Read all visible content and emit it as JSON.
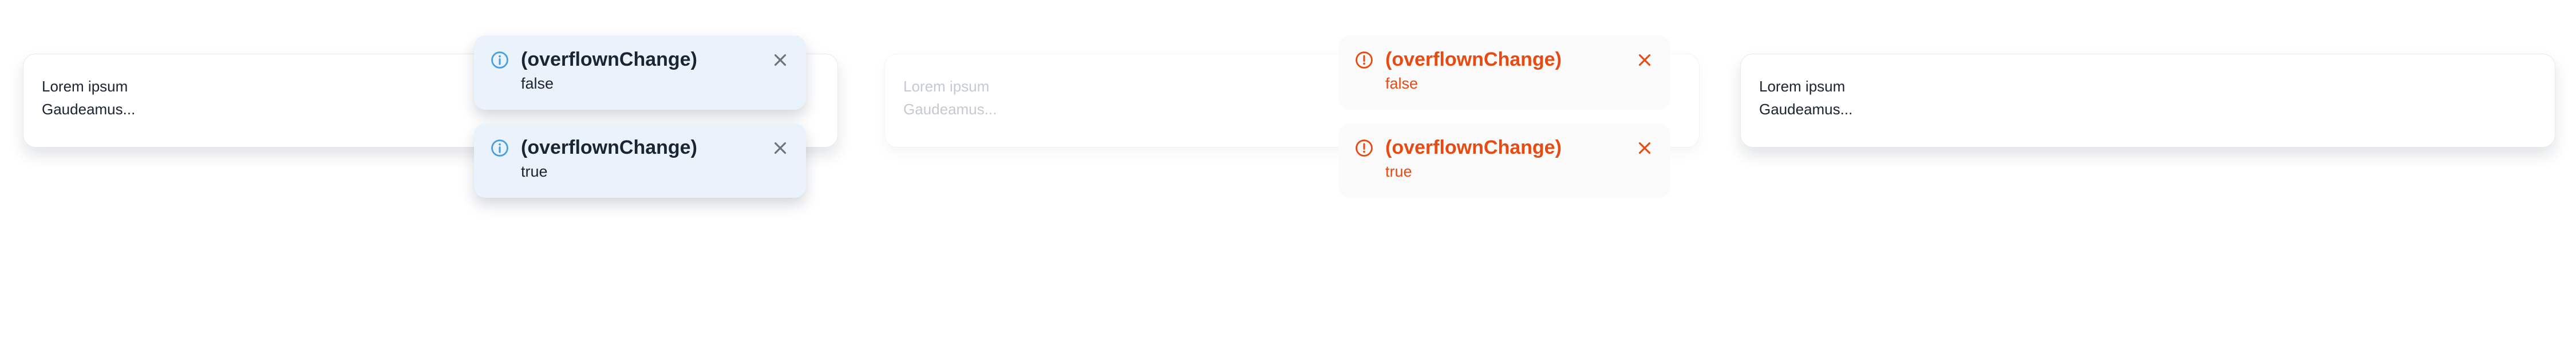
{
  "cards": [
    {
      "line1": "Lorem ipsum",
      "line2": "Gaudeamus..."
    },
    {
      "line1": "Lorem ipsum",
      "line2": "Gaudeamus..."
    },
    {
      "line1": "Lorem ipsum",
      "line2": "Gaudeamus..."
    }
  ],
  "info_toasts": [
    {
      "title": "(overflownChange)",
      "message": "false",
      "icon": "info-icon",
      "close_icon": "close-icon"
    },
    {
      "title": "(overflownChange)",
      "message": "true",
      "icon": "info-icon",
      "close_icon": "close-icon"
    }
  ],
  "error_toasts": [
    {
      "title": "(overflownChange)",
      "message": "false",
      "icon": "error-icon",
      "close_icon": "close-icon"
    },
    {
      "title": "(overflownChange)",
      "message": "true",
      "icon": "error-icon",
      "close_icon": "close-icon"
    }
  ],
  "colors": {
    "info_background": "#eaf3fc",
    "info_icon": "#4a9fe0",
    "error_accent": "#e84a12",
    "text_dark": "#1b2432",
    "text_faded": "#c5cad1"
  }
}
